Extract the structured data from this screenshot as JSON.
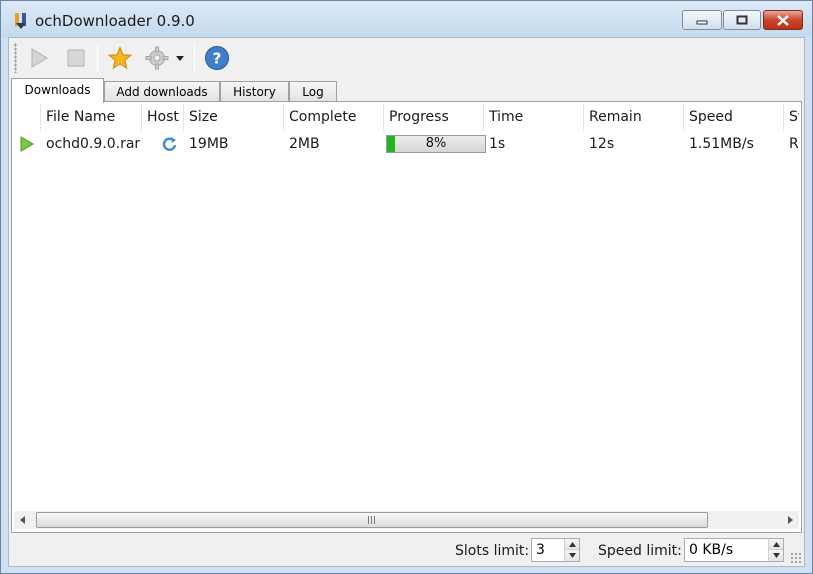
{
  "window": {
    "title": "ochDownloader 0.9.0",
    "icon": "app-icon"
  },
  "toolbar": {
    "buttons": [
      {
        "name": "start",
        "icon": "play-icon",
        "enabled": false
      },
      {
        "name": "stop",
        "icon": "stop-icon",
        "enabled": false
      },
      {
        "name": "favorites",
        "icon": "star-icon",
        "enabled": true
      },
      {
        "name": "settings",
        "icon": "gear-icon",
        "enabled": false
      },
      {
        "name": "help",
        "icon": "help-icon",
        "enabled": true
      }
    ]
  },
  "tabs": [
    {
      "label": "Downloads",
      "active": true
    },
    {
      "label": "Add downloads",
      "active": false
    },
    {
      "label": "History",
      "active": false
    },
    {
      "label": "Log",
      "active": false
    }
  ],
  "table": {
    "columns": [
      "File Name",
      "Host",
      "Size",
      "Complete",
      "Progress",
      "Time",
      "Remain",
      "Speed",
      "St"
    ],
    "rows": [
      {
        "status_icon": "play-icon",
        "file_name": "ochd0.9.0.rar",
        "host_icon": "refresh-icon",
        "size": "19MB",
        "complete": "2MB",
        "progress": 0.08,
        "progress_label": "8%",
        "time": "1s",
        "remain": "12s",
        "speed": "1.51MB/s",
        "status": "Ru"
      }
    ]
  },
  "statusbar": {
    "slots_label": "Slots limit:",
    "slots_value": "3",
    "speed_label": "Speed limit:",
    "speed_value": "0 KB/s"
  },
  "colors": {
    "progress_fill": "#22b422",
    "play_green": "#6bbf3a",
    "close_red": "#c8452c"
  }
}
